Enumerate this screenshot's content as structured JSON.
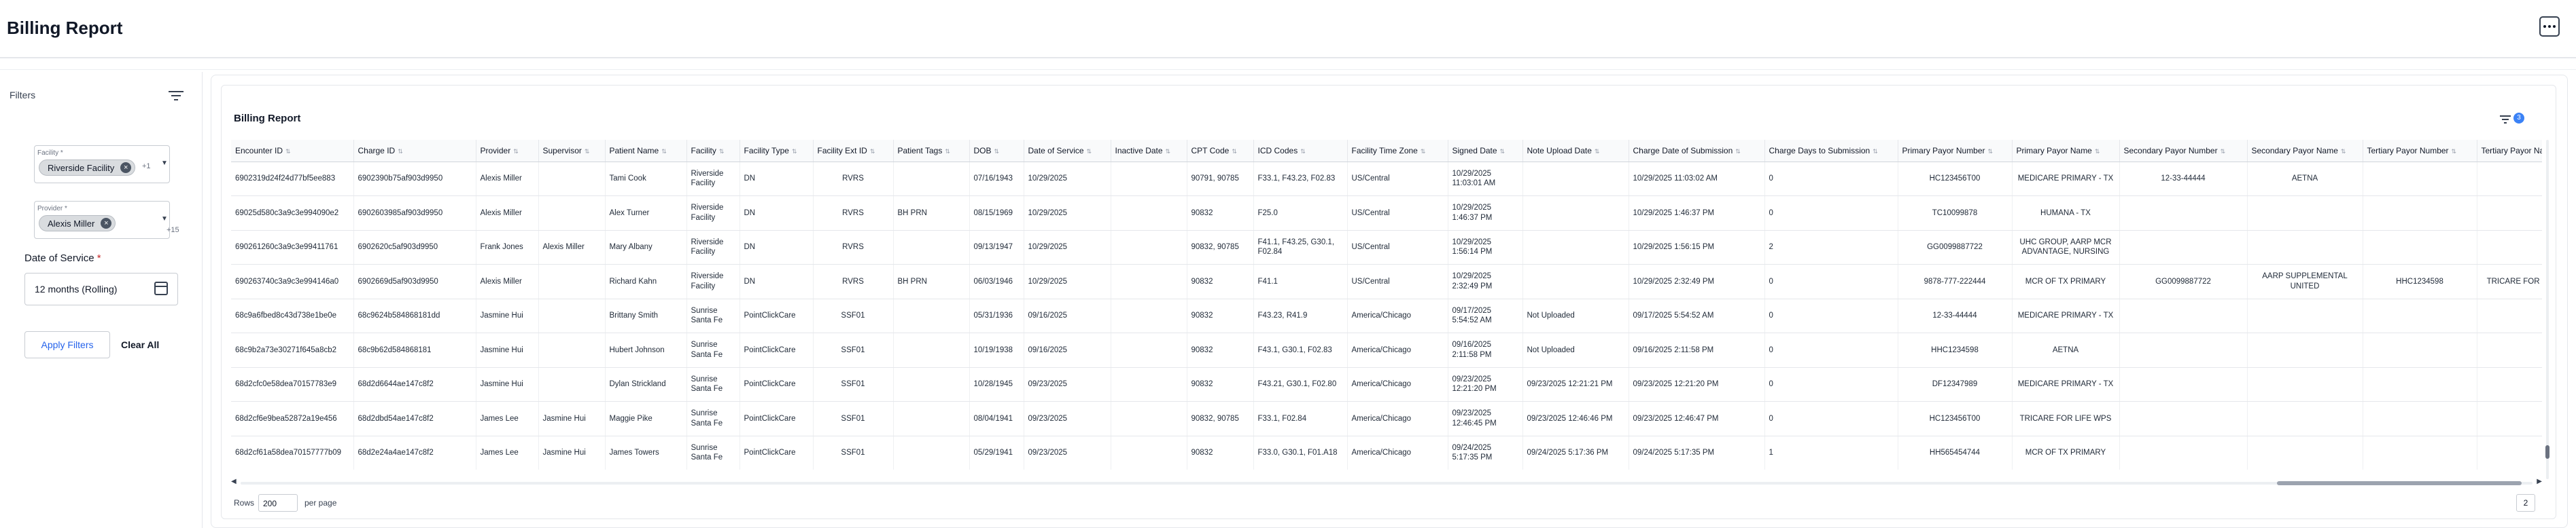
{
  "header": {
    "title": "Billing Report",
    "more_icon": "more-horizontal-icon"
  },
  "filters": {
    "heading": "Filters",
    "toggle_icon": "filter-lines-icon",
    "facility": {
      "label": "Facility *",
      "chip": "Riverside Facility",
      "more": "+1"
    },
    "provider": {
      "label": "Provider *",
      "chip": "Alexis Miller",
      "more": "+15"
    },
    "date_of_service": {
      "label": "Date of Service",
      "required_mark": "*",
      "value": "12 months (Rolling)",
      "icon": "calendar-icon"
    },
    "apply_label": "Apply Filters",
    "clear_label": "Clear All"
  },
  "report": {
    "title": "Billing Report",
    "filter_icon": "filter-icon",
    "active_filter_count": "3",
    "columns": [
      "Encounter ID",
      "Charge ID",
      "Provider",
      "Supervisor",
      "Patient Name",
      "Facility",
      "Facility Type",
      "Facility Ext ID",
      "Patient Tags",
      "DOB",
      "Date of Service",
      "Inactive Date",
      "CPT Code",
      "ICD Codes",
      "Facility Time Zone",
      "Signed Date",
      "Note Upload Date",
      "Charge Date of Submission",
      "Charge Days to Submission",
      "Primary Payor Number",
      "Primary Payor Name",
      "Secondary Payor Number",
      "Secondary Payor Name",
      "Tertiary Payor Number",
      "Tertiary Payor Name"
    ],
    "rows": [
      [
        "6902319d24f24d77bf5ee883",
        "6902390b75af903d9950",
        "Alexis Miller",
        "",
        "Tami Cook",
        "Riverside Facility",
        "DN",
        "RVRS",
        "",
        "07/16/1943",
        "10/29/2025",
        "",
        "90791, 90785",
        "F33.1, F43.23, F02.83",
        "US/Central",
        "10/29/2025 11:03:01 AM",
        "",
        "10/29/2025 11:03:02 AM",
        "0",
        "HC123456T00",
        "MEDICARE PRIMARY - TX",
        "12-33-44444",
        "AETNA",
        "",
        ""
      ],
      [
        "69025d580c3a9c3e994090e2",
        "6902603985af903d9950",
        "Alexis Miller",
        "",
        "Alex Turner",
        "Riverside Facility",
        "DN",
        "RVRS",
        "BH PRN",
        "08/15/1969",
        "10/29/2025",
        "",
        "90832",
        "F25.0",
        "US/Central",
        "10/29/2025 1:46:37 PM",
        "",
        "10/29/2025 1:46:37 PM",
        "0",
        "TC10099878",
        "HUMANA - TX",
        "",
        "",
        "",
        ""
      ],
      [
        "690261260c3a9c3e99411761",
        "6902620c5af903d9950",
        "Frank Jones",
        "Alexis Miller",
        "Mary Albany",
        "Riverside Facility",
        "DN",
        "RVRS",
        "",
        "09/13/1947",
        "10/29/2025",
        "",
        "90832, 90785",
        "F41.1, F43.25, G30.1, F02.84",
        "US/Central",
        "10/29/2025 1:56:14 PM",
        "",
        "10/29/2025 1:56:15 PM",
        "2",
        "GG0099887722",
        "UHC GROUP, AARP MCR ADVANTAGE, NURSING",
        "",
        "",
        "",
        ""
      ],
      [
        "690263740c3a9c3e994146a0",
        "6902669d5af903d9950",
        "Alexis Miller",
        "",
        "Richard Kahn",
        "Riverside Facility",
        "DN",
        "RVRS",
        "BH PRN",
        "06/03/1946",
        "10/29/2025",
        "",
        "90832",
        "F41.1",
        "US/Central",
        "10/29/2025 2:32:49 PM",
        "",
        "10/29/2025 2:32:49 PM",
        "0",
        "9878-777-222444",
        "MCR OF TX PRIMARY",
        "GG0099887722",
        "AARP SUPPLEMENTAL UNITED",
        "HHC1234598",
        "TRICARE FOR LIFE WPS"
      ],
      [
        "68c9a6fbed8c43d738e1be0e",
        "68c9624b584868181dd",
        "Jasmine Hui",
        "",
        "Brittany Smith",
        "Sunrise Santa Fe",
        "PointClickCare",
        "SSF01",
        "",
        "05/31/1936",
        "09/16/2025",
        "",
        "90832",
        "F43.23, R41.9",
        "America/Chicago",
        "09/17/2025 5:54:52 AM",
        "Not Uploaded",
        "09/17/2025 5:54:52 AM",
        "0",
        "12-33-44444",
        "MEDICARE PRIMARY - TX",
        "",
        "",
        "",
        ""
      ],
      [
        "68c9b2a73e30271f645a8cb2",
        "68c9b62d584868181",
        "Jasmine Hui",
        "",
        "Hubert Johnson",
        "Sunrise Santa Fe",
        "PointClickCare",
        "SSF01",
        "",
        "10/19/1938",
        "09/16/2025",
        "",
        "90832",
        "F43.1, G30.1, F02.83",
        "America/Chicago",
        "09/16/2025 2:11:58 PM",
        "Not Uploaded",
        "09/16/2025 2:11:58 PM",
        "0",
        "HHC1234598",
        "AETNA",
        "",
        "",
        "",
        ""
      ],
      [
        "68d2cfc0e58dea70157783e9",
        "68d2d6644ae147c8f2",
        "Jasmine Hui",
        "",
        "Dylan Strickland",
        "Sunrise Santa Fe",
        "PointClickCare",
        "SSF01",
        "",
        "10/28/1945",
        "09/23/2025",
        "",
        "90832",
        "F43.21, G30.1, F02.80",
        "America/Chicago",
        "09/23/2025 12:21:20 PM",
        "09/23/2025 12:21:21 PM",
        "09/23/2025 12:21:20 PM",
        "0",
        "DF12347989",
        "MEDICARE PRIMARY - TX",
        "",
        "",
        "",
        ""
      ],
      [
        "68d2cf6e9bea52872a19e456",
        "68d2dbd54ae147c8f2",
        "James Lee",
        "Jasmine Hui",
        "Maggie Pike",
        "Sunrise Santa Fe",
        "PointClickCare",
        "SSF01",
        "",
        "08/04/1941",
        "09/23/2025",
        "",
        "90832, 90785",
        "F33.1, F02.84",
        "America/Chicago",
        "09/23/2025 12:46:45 PM",
        "09/23/2025 12:46:46 PM",
        "09/23/2025 12:46:47 PM",
        "0",
        "HC123456T00",
        "TRICARE FOR LIFE WPS",
        "",
        "",
        "",
        ""
      ],
      [
        "68d2cf61a58dea70157777b09",
        "68d2e24a4ae147c8f2",
        "James Lee",
        "Jasmine Hui",
        "James Towers",
        "Sunrise Santa Fe",
        "PointClickCare",
        "SSF01",
        "",
        "05/29/1941",
        "09/23/2025",
        "",
        "90832",
        "F33.0, G30.1, F01.A18",
        "America/Chicago",
        "09/24/2025 5:17:35 PM",
        "09/24/2025 5:17:36 PM",
        "09/24/2025 5:17:35 PM",
        "1",
        "HH565454744",
        "MCR OF TX PRIMARY",
        "",
        "",
        "",
        ""
      ]
    ]
  },
  "pagination": {
    "rows_label": "Rows",
    "rows_value": "200",
    "per_page_label": "per page",
    "page": "2"
  },
  "colors": {
    "accent": "#2563eb",
    "badge": "#3b82f6",
    "required": "#c62828"
  }
}
